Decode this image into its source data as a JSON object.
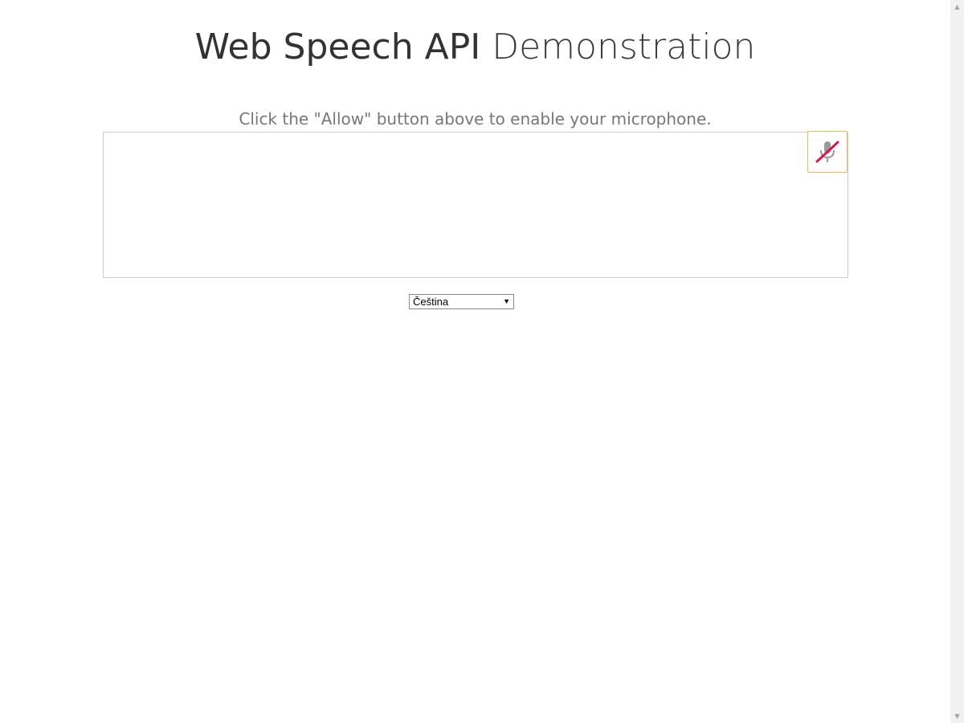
{
  "header": {
    "title_bold": "Web Speech API",
    "title_light": "Demonstration"
  },
  "info": {
    "message": "Click the \"Allow\" button above to enable your microphone."
  },
  "results": {
    "text": ""
  },
  "mic_button": {
    "icon": "mic-slash-icon",
    "state": "blocked",
    "border_color": "#f0b84f",
    "slash_color": "#e0144c"
  },
  "language_select": {
    "selected": "Čeština"
  },
  "scrollbar": {
    "up_arrow": "▲",
    "down_arrow": "▼"
  }
}
